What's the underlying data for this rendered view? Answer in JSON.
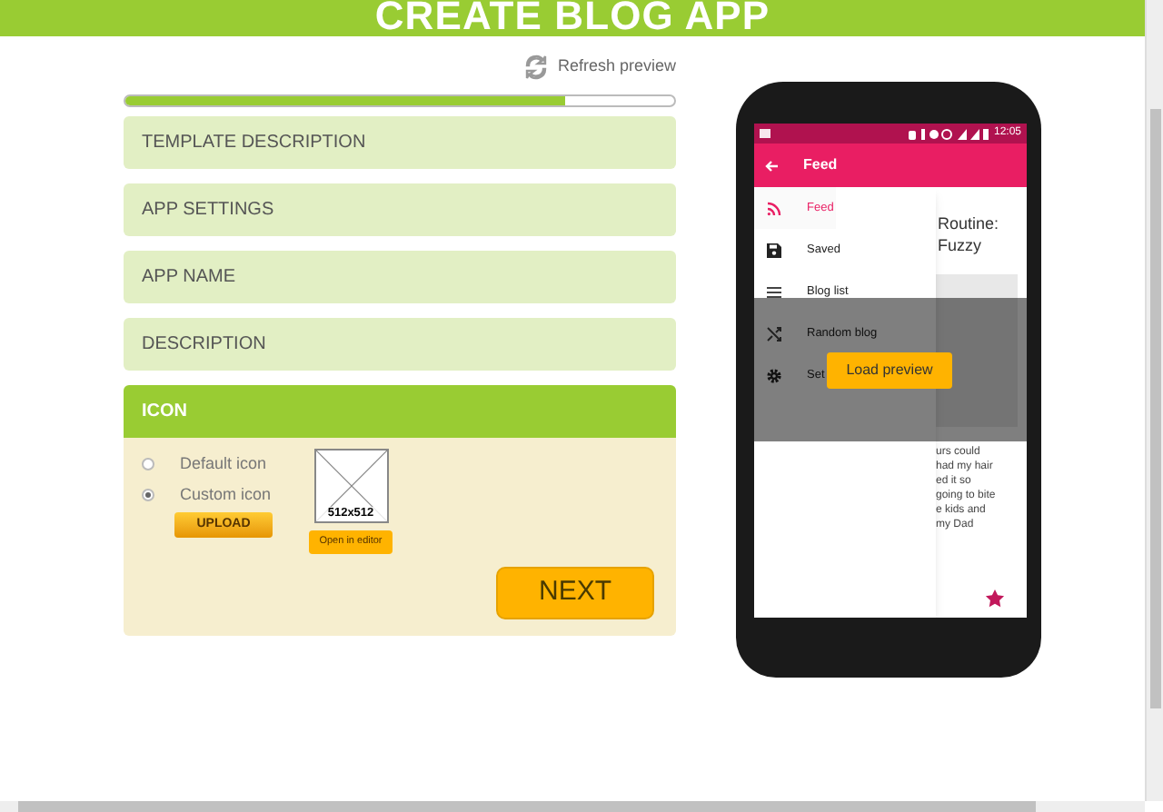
{
  "header": {
    "title": "CREATE BLOG APP"
  },
  "refresh": {
    "label": "Refresh preview"
  },
  "progress": {
    "level": 0.8
  },
  "sections": [
    {
      "label": "TEMPLATE DESCRIPTION",
      "expanded": false
    },
    {
      "label": "APP SETTINGS",
      "expanded": false
    },
    {
      "label": "APP NAME",
      "expanded": false
    },
    {
      "label": "DESCRIPTION",
      "expanded": false
    },
    {
      "label": "ICON",
      "expanded": true
    }
  ],
  "icon_options": [
    {
      "label": "Default icon",
      "selected": false
    },
    {
      "label": "Custom icon",
      "selected": true
    }
  ],
  "upload_button": "UPLOAD",
  "icon_preview": {
    "size_label": "512x512",
    "editor_button": "Open in editor"
  },
  "next_button": "NEXT",
  "phone": {
    "status_time": "12:05",
    "app_bar_title": "Feed",
    "drawer_items": [
      {
        "kind": "rss",
        "label": "Feed",
        "selected": true
      },
      {
        "kind": "save",
        "label": "Saved",
        "selected": false
      },
      {
        "kind": "list",
        "label": "Blog list",
        "selected": false
      },
      {
        "kind": "shuffle",
        "label": "Random blog",
        "selected": false
      },
      {
        "kind": "gear",
        "label": "Set",
        "selected": false
      }
    ],
    "content_title": [
      "Routine:",
      "Fuzzy"
    ],
    "content_text": [
      "urs could",
      "had my hair",
      "ed it so",
      "going to bite",
      "e kids and",
      "my Dad"
    ],
    "load_preview_button": "Load preview"
  }
}
